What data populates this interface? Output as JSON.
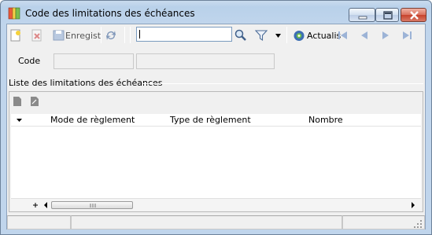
{
  "window": {
    "title": "Code des limitations des échéances",
    "controls": [
      "minimize",
      "maximize",
      "close"
    ]
  },
  "toolbar": {
    "new_icon": "new-document-icon",
    "delete_icon": "delete-icon",
    "save_label": "Enregist",
    "refresh_icon": "refresh-icon",
    "search_value": "",
    "filter_icon": "filter-icon",
    "update_label": "Actualis",
    "nav": [
      "first-record-icon",
      "previous-record-icon",
      "next-record-icon",
      "last-record-icon"
    ]
  },
  "form": {
    "code_label": "Code",
    "code_value": "",
    "description_value": ""
  },
  "list": {
    "section_title": "Liste des limitations des échéances",
    "columns": [
      "Mode de règlement",
      "Type de règlement",
      "Nombre"
    ],
    "rows": []
  },
  "colors": {
    "titlebar": "#b9d1ea",
    "close_button": "#c7432c",
    "accent_blue": "#3a72c8"
  }
}
